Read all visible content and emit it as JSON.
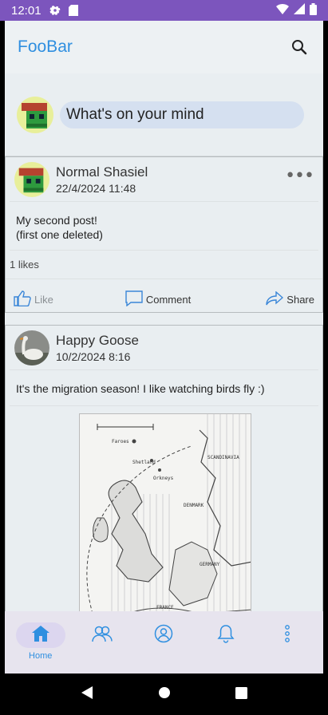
{
  "status_bar": {
    "time": "12:01",
    "icons": [
      "gear-icon",
      "sd-card-icon",
      "wifi-icon",
      "signal-icon",
      "battery-icon"
    ]
  },
  "app": {
    "title": "FooBar",
    "search_icon": "search-icon"
  },
  "composer": {
    "placeholder": "What's on your mind"
  },
  "posts": [
    {
      "author": "Normal Shasiel",
      "time": "22/4/2024 11:48",
      "text_lines": [
        "My second post!",
        "(first one deleted)"
      ],
      "likes": "1 likes",
      "actions": {
        "like": "Like",
        "comment": "Comment",
        "share": "Share"
      }
    },
    {
      "author": "Happy Goose",
      "time": "10/2/2024 8:16",
      "text": "It's the migration season! I like watching birds fly :)",
      "image_labels": [
        "SCANDINAVIA",
        "DENMARK",
        "GERMANY",
        "FRANCE",
        "Shetland",
        "Faroes",
        "Orkneys"
      ]
    }
  ],
  "bottom_nav": {
    "items": [
      {
        "icon": "home-icon",
        "label": "Home",
        "active": true
      },
      {
        "icon": "friends-icon",
        "label": "",
        "active": false
      },
      {
        "icon": "profile-icon",
        "label": "",
        "active": false
      },
      {
        "icon": "bell-icon",
        "label": "",
        "active": false
      },
      {
        "icon": "more-vert-icon",
        "label": "",
        "active": false
      }
    ]
  },
  "colors": {
    "accent": "#2f8fe0",
    "status_bar": "#7c55bd",
    "screen_bg": "#e9eef1"
  }
}
